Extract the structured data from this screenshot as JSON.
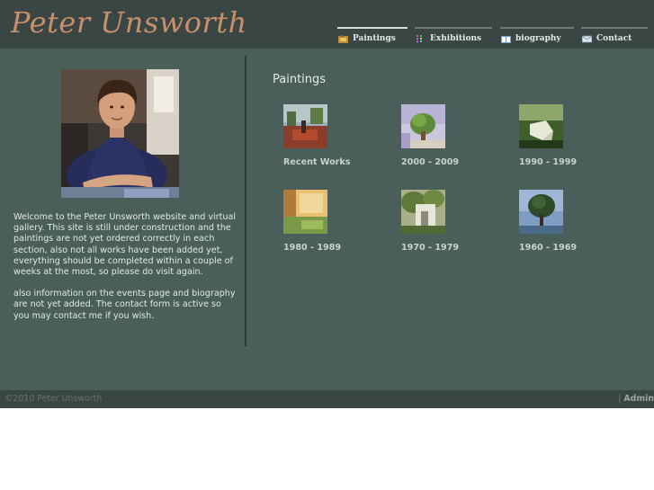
{
  "header": {
    "logo_text": "Peter Unsworth"
  },
  "nav": [
    {
      "label": "Paintings",
      "icon": "paintings-icon",
      "active": true
    },
    {
      "label": "Exhibitions",
      "icon": "exhibitions-icon",
      "active": false
    },
    {
      "label": "biography",
      "icon": "biography-icon",
      "active": false
    },
    {
      "label": "Contact",
      "icon": "contact-icon",
      "active": false
    }
  ],
  "sidebar": {
    "welcome_paragraphs": [
      "Welcome to the  Peter Unsworth website and virtual gallery. This site is still under construction and the paintings are not yet ordered correctly in each section, also not all works have been added yet, everything should be completed within a couple of weeks at the most, so please do visit again.",
      "also information on the events page and biography are not yet added. The contact form is active so you may contact me if you wish."
    ]
  },
  "main": {
    "title": "Paintings",
    "galleries": [
      {
        "label": "Recent Works"
      },
      {
        "label": "2000 - 2009"
      },
      {
        "label": "1990 - 1999"
      },
      {
        "label": "1980 - 1989"
      },
      {
        "label": "1970 - 1979"
      },
      {
        "label": "1960 - 1969"
      }
    ]
  },
  "footer": {
    "copyright": "©2010 Peter Unsworth",
    "admin_sep": "|",
    "admin_label": "Admin"
  },
  "colors": {
    "header_bg": "#3a4644",
    "main_bg": "#4a5f5a",
    "logo": "#c98f6a"
  }
}
